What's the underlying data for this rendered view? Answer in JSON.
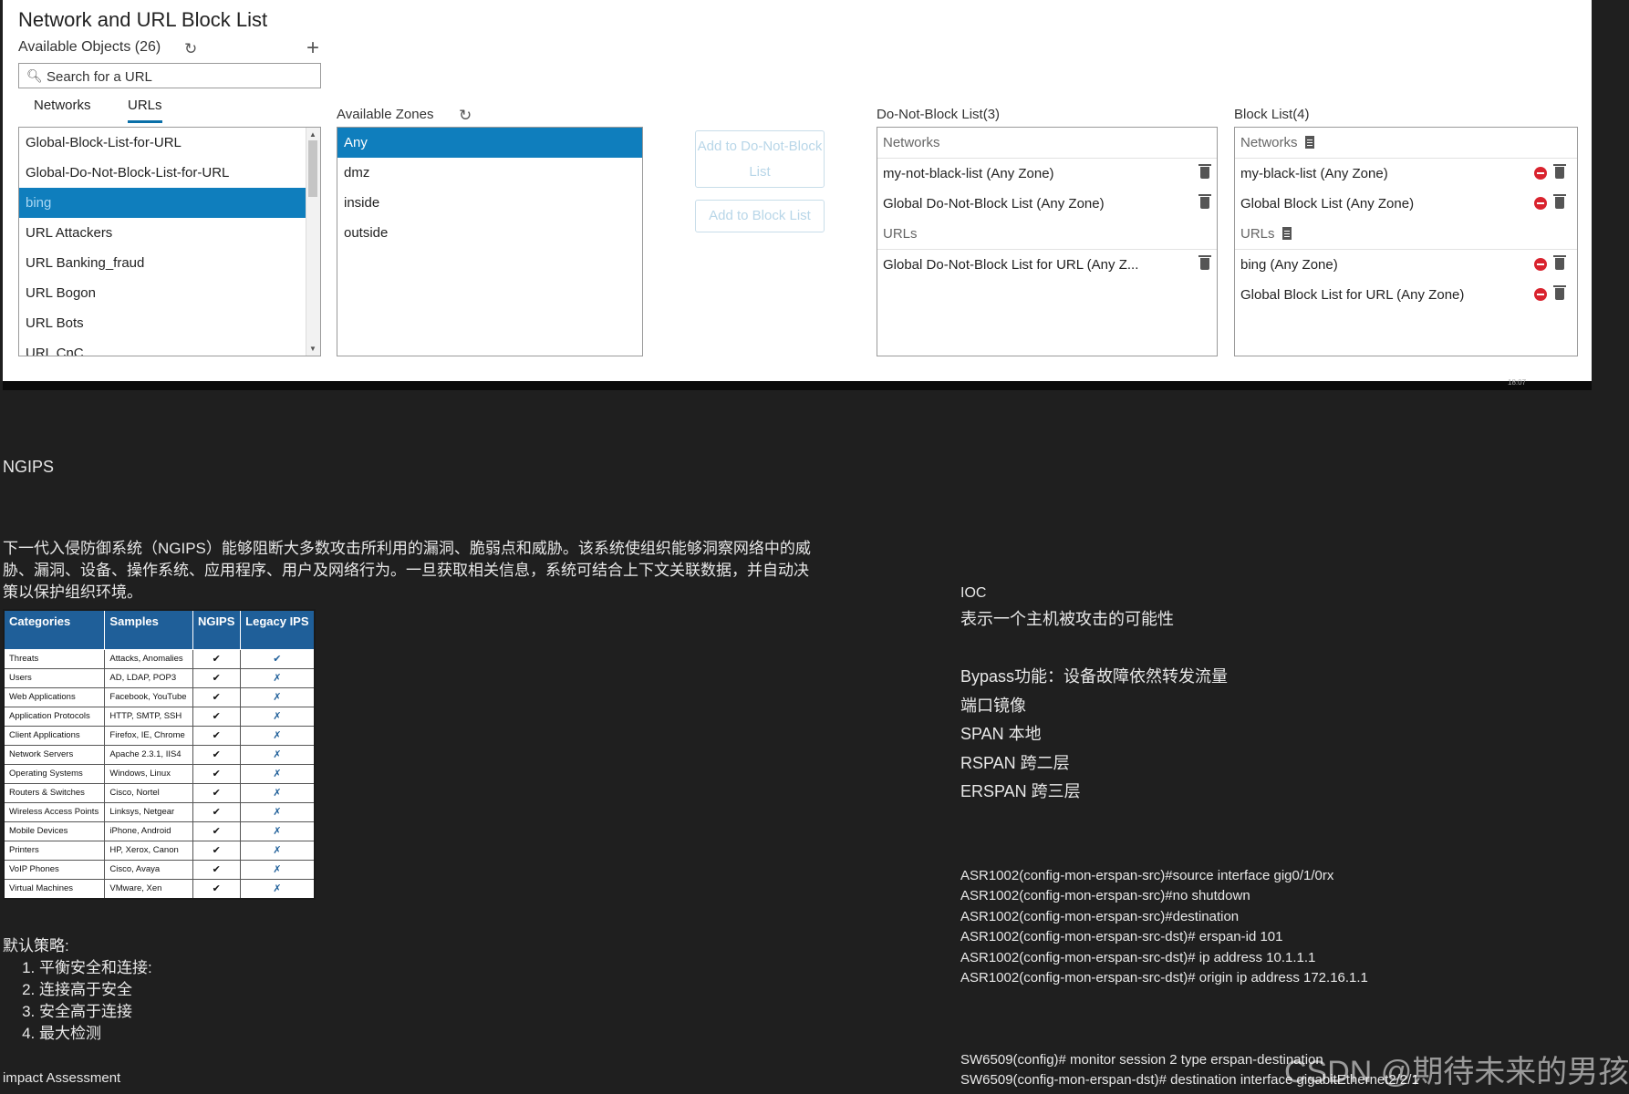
{
  "dialog": {
    "title": "Network and URL Block List",
    "available_objects_label": "Available Objects (26)",
    "search_placeholder": "Search for a URL",
    "tabs": [
      "Networks",
      "URLs"
    ],
    "active_tab": "URLs",
    "objects": [
      "Global-Block-List-for-URL",
      "Global-Do-Not-Block-List-for-URL",
      "bing",
      "URL Attackers",
      "URL Banking_fraud",
      "URL Bogon",
      "URL Bots",
      "URL CnC"
    ],
    "selected_object": "bing",
    "zones_label": "Available Zones",
    "zones": [
      "Any",
      "dmz",
      "inside",
      "outside"
    ],
    "selected_zone": "Any",
    "add_do_not_block_label": "Add to Do-Not-Block List",
    "add_block_label": "Add to Block List",
    "do_not_block": {
      "title": "Do-Not-Block List(3)",
      "networks_header": "Networks",
      "networks": [
        "my-not-black-list (Any Zone)",
        "Global Do-Not-Block List (Any Zone)"
      ],
      "urls_header": "URLs",
      "urls": [
        "Global Do-Not-Block List for URL (Any Z..."
      ]
    },
    "block": {
      "title": "Block List(4)",
      "networks_header": "Networks",
      "networks": [
        "my-black-list (Any Zone)",
        "Global Block List (Any Zone)"
      ],
      "urls_header": "URLs",
      "urls": [
        "bing (Any Zone)",
        "Global Block List for URL (Any Zone)"
      ]
    },
    "taskbar_time": "18:07"
  },
  "doc": {
    "ngips_title": "NGIPS",
    "ngips_desc": "下一代入侵防御系统（NGIPS）能够阻断大多数攻击所利用的漏洞、脆弱点和威胁。该系统使组织能够洞察网络中的威胁、漏洞、设备、操作系统、应用程序、用户及网络行为。一旦获取相关信息，系统可结合上下文关联数据，并自动决策以保护组织环境。",
    "table": {
      "headers": [
        "Categories",
        "Samples",
        "NGIPS",
        "Legacy IPS"
      ],
      "rows": [
        {
          "cat": "Threats",
          "sample": "Attacks, Anomalies",
          "ngips": "✔",
          "legacy": "✔"
        },
        {
          "cat": "Users",
          "sample": "AD, LDAP, POP3",
          "ngips": "✔",
          "legacy": "✗"
        },
        {
          "cat": "Web Applications",
          "sample": "Facebook, YouTube",
          "ngips": "✔",
          "legacy": "✗"
        },
        {
          "cat": "Application Protocols",
          "sample": "HTTP, SMTP, SSH",
          "ngips": "✔",
          "legacy": "✗"
        },
        {
          "cat": "Client Applications",
          "sample": "Firefox, IE, Chrome",
          "ngips": "✔",
          "legacy": "✗"
        },
        {
          "cat": "Network Servers",
          "sample": "Apache 2.3.1, IIS4",
          "ngips": "✔",
          "legacy": "✗"
        },
        {
          "cat": "Operating Systems",
          "sample": "Windows, Linux",
          "ngips": "✔",
          "legacy": "✗"
        },
        {
          "cat": "Routers & Switches",
          "sample": "Cisco, Nortel",
          "ngips": "✔",
          "legacy": "✗"
        },
        {
          "cat": "Wireless Access Points",
          "sample": "Linksys, Netgear",
          "ngips": "✔",
          "legacy": "✗"
        },
        {
          "cat": "Mobile Devices",
          "sample": "iPhone, Android",
          "ngips": "✔",
          "legacy": "✗"
        },
        {
          "cat": "Printers",
          "sample": "HP, Xerox, Canon",
          "ngips": "✔",
          "legacy": "✗"
        },
        {
          "cat": "VoIP Phones",
          "sample": "Cisco, Avaya",
          "ngips": "✔",
          "legacy": "✗"
        },
        {
          "cat": "Virtual Machines",
          "sample": "VMware, Xen",
          "ngips": "✔",
          "legacy": "✗"
        }
      ]
    },
    "policy_title": "默认策略:",
    "policies": [
      "平衡安全和连接:",
      "连接高于安全",
      "安全高于连接",
      "最大检测"
    ],
    "impact_label": "impact Assessment",
    "ioc_label": "IOC",
    "right_lines": [
      "表示一个主机被攻击的可能性",
      "",
      "Bypass功能：设备故障依然转发流量",
      "端口镜像",
      "SPAN 本地",
      "RSPAN 跨二层",
      "ERSPAN 跨三层"
    ],
    "code_block_1": [
      "ASR1002(config-mon-erspan-src)#source interface gig0/1/0rx",
      "ASR1002(config-mon-erspan-src)#no shutdown",
      "ASR1002(config-mon-erspan-src)#destination",
      "ASR1002(config-mon-erspan-src-dst)# erspan-id 101",
      "ASR1002(config-mon-erspan-src-dst)# ip address 10.1.1.1",
      "ASR1002(config-mon-erspan-src-dst)# origin ip address 172.16.1.1"
    ],
    "code_block_2": [
      "SW6509(config)# monitor session 2 type erspan-destination",
      "SW6509(config-mon-erspan-dst)# destination interface gigabitEthernet2/2/1"
    ],
    "watermark": "CSDN @期待未来的男孩"
  }
}
